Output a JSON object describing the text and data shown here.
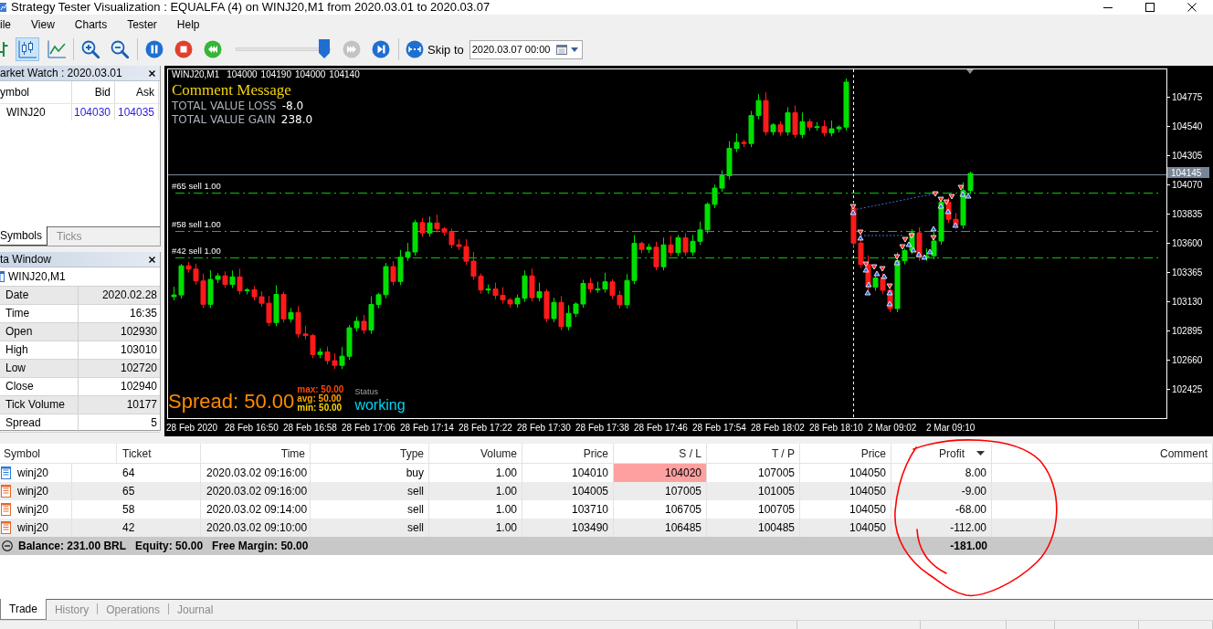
{
  "window": {
    "title": "Strategy Tester Visualization : EQUALFA (4) on WINJ20,M1 from 2020.03.01 to 2020.03.07"
  },
  "menu": [
    "ile",
    "View",
    "Charts",
    "Tester",
    "Help"
  ],
  "toolbar": {
    "chart_modes": [
      {
        "kind": "bars",
        "selected": false
      },
      {
        "kind": "candles",
        "selected": true
      },
      {
        "kind": "line",
        "selected": false
      }
    ],
    "zoom": [
      {
        "kind": "zoom-in"
      },
      {
        "kind": "zoom-out"
      }
    ],
    "playback": [
      {
        "kind": "pause",
        "disabled": false
      },
      {
        "kind": "stop",
        "disabled": false
      },
      {
        "kind": "rewind",
        "disabled": false
      }
    ],
    "speed_slider": {
      "level": 1
    },
    "stepping": [
      {
        "kind": "fast-forward",
        "disabled": true
      },
      {
        "kind": "skip-end",
        "disabled": false
      }
    ],
    "skip_to": {
      "label": "Skip to",
      "date": "2020.03.07 00:00"
    }
  },
  "market_watch": {
    "title": "arket Watch : 2020.03.01",
    "columns": [
      "ymbol",
      "Bid",
      "Ask"
    ],
    "rows": [
      {
        "symbol": "WINJ20",
        "bid": "104030",
        "ask": "104035"
      }
    ],
    "tabs": [
      {
        "label": "Symbols",
        "selected": true
      },
      {
        "label": "Ticks",
        "selected": false
      }
    ]
  },
  "data_window": {
    "title": "ta Window",
    "symbol": "WINJ20,M1",
    "rows": [
      {
        "label": "Date",
        "value": "2020.02.28"
      },
      {
        "label": "Time",
        "value": "16:35"
      },
      {
        "label": "Open",
        "value": "102930"
      },
      {
        "label": "High",
        "value": "103010"
      },
      {
        "label": "Low",
        "value": "102720"
      },
      {
        "label": "Close",
        "value": "102940"
      },
      {
        "label": "Tick Volume",
        "value": "10177"
      },
      {
        "label": "Spread",
        "value": "5"
      }
    ]
  },
  "chart": {
    "header": {
      "symbol": "WINJ20,M1",
      "values": [
        "104000",
        "104190",
        "104000",
        "104140"
      ]
    },
    "comment": {
      "title": "Comment Message",
      "lines": [
        {
          "label": "TOTAL VALUE LOSS",
          "value": "-8.0"
        },
        {
          "label": "TOTAL VALUE GAIN",
          "value": "238.0"
        }
      ]
    },
    "order_lines": [
      {
        "label": "#65 sell 1.00"
      },
      {
        "label": "#58 sell 1.00"
      },
      {
        "label": "#42 sell 1.00"
      }
    ],
    "price_axis": {
      "labels": [
        "104775",
        "104540",
        "104305",
        "104070",
        "103835",
        "103600",
        "103365",
        "103130",
        "102895",
        "102660",
        "102425"
      ],
      "current_price": "104145"
    },
    "time_axis": {
      "labels": [
        "28 Feb 2020",
        "28 Feb 16:50",
        "28 Feb 16:58",
        "28 Feb 17:06",
        "28 Feb 17:14",
        "28 Feb 17:22",
        "28 Feb 17:30",
        "28 Feb 17:38",
        "28 Feb 17:46",
        "28 Feb 17:54",
        "28 Feb 18:02",
        "28 Feb 18:10",
        "2 Mar 09:02",
        "2 Mar 09:10"
      ]
    },
    "spread": {
      "label": "Spread: 50.00",
      "stats": [
        {
          "text": "max: 50.00",
          "color": "#ff4500"
        },
        {
          "text": "avg: 50.00",
          "color": "#ffa500"
        },
        {
          "text": "min: 50.00",
          "color": "#ffd700"
        }
      ]
    },
    "status": {
      "label": "Status",
      "value": "working"
    }
  },
  "trade_table": {
    "columns": [
      {
        "label": "Symbol",
        "sorted": false
      },
      {
        "label": "Ticket",
        "sorted": false
      },
      {
        "label": "Time",
        "sorted": false
      },
      {
        "label": "Type",
        "sorted": false
      },
      {
        "label": "Volume",
        "sorted": false
      },
      {
        "label": "Price",
        "sorted": false
      },
      {
        "label": "S / L",
        "sorted": false
      },
      {
        "label": "T / P",
        "sorted": false
      },
      {
        "label": "Price",
        "sorted": false
      },
      {
        "label": "Profit",
        "sorted": true
      },
      {
        "label": "Comment",
        "sorted": false
      }
    ],
    "rows": [
      {
        "kind": "buy",
        "symbol": "winj20",
        "ticket": "64",
        "time": "2020.03.02 09:16:00",
        "type": "buy",
        "volume": "1.00",
        "price": "104010",
        "sl": "104020",
        "sl_alert": true,
        "tp": "107005",
        "market_price": "104050",
        "profit": "8.00"
      },
      {
        "kind": "sell",
        "symbol": "winj20",
        "ticket": "65",
        "time": "2020.03.02 09:16:00",
        "type": "sell",
        "volume": "1.00",
        "price": "104005",
        "sl": "107005",
        "sl_alert": false,
        "tp": "101005",
        "market_price": "104050",
        "profit": "-9.00"
      },
      {
        "kind": "sell",
        "symbol": "winj20",
        "ticket": "58",
        "time": "2020.03.02 09:14:00",
        "type": "sell",
        "volume": "1.00",
        "price": "103710",
        "sl": "106705",
        "sl_alert": false,
        "tp": "100705",
        "market_price": "104050",
        "profit": "-68.00"
      },
      {
        "kind": "sell",
        "symbol": "winj20",
        "ticket": "42",
        "time": "2020.03.02 09:10:00",
        "type": "sell",
        "volume": "1.00",
        "price": "103490",
        "sl": "106485",
        "sl_alert": false,
        "tp": "100485",
        "market_price": "104050",
        "profit": "-112.00"
      }
    ],
    "summary": {
      "items": [
        "Balance: 231.00 BRL",
        "Equity: 50.00",
        "Free Margin: 50.00"
      ],
      "profit": "-181.00"
    }
  },
  "bottom_tabs": [
    {
      "label": "Trade",
      "selected": true
    },
    {
      "label": "History",
      "selected": false
    },
    {
      "label": "Operations",
      "selected": false
    },
    {
      "label": "Journal",
      "selected": false
    }
  ]
}
